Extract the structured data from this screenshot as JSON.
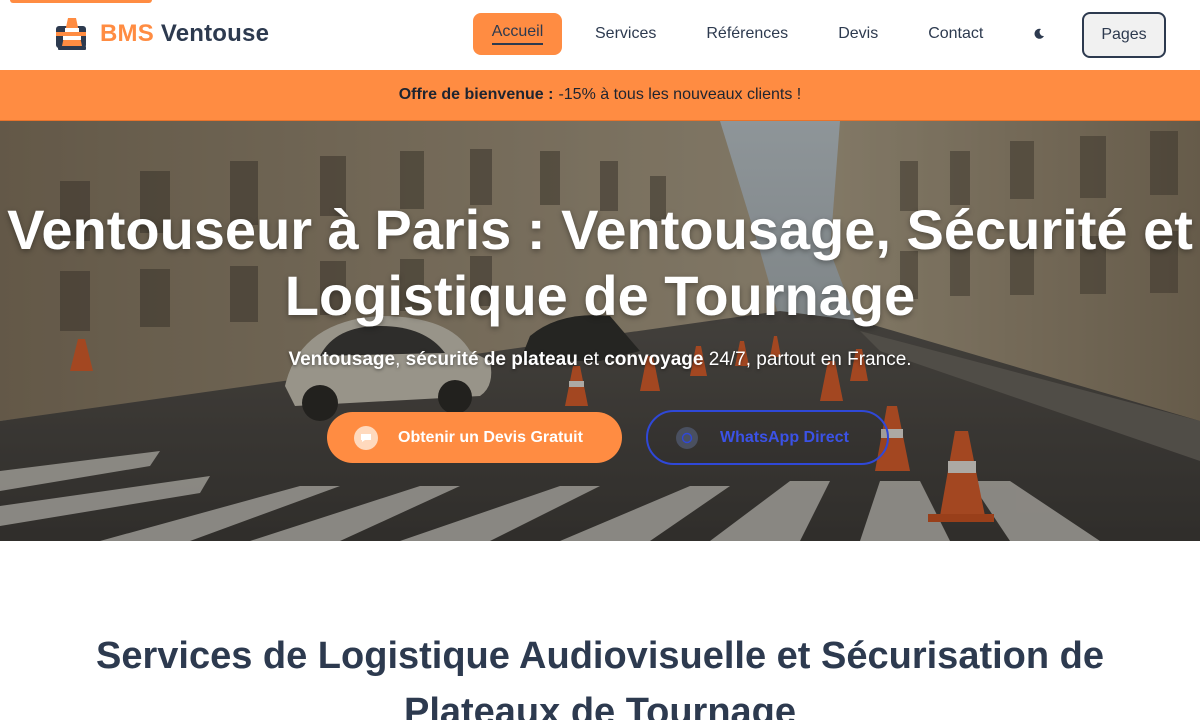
{
  "brand": {
    "name_part1": "BMS",
    "name_part2": "Ventouse"
  },
  "nav": {
    "items": [
      {
        "label": "Accueil",
        "active": true
      },
      {
        "label": "Services"
      },
      {
        "label": "Références"
      },
      {
        "label": "Devis"
      },
      {
        "label": "Contact"
      }
    ],
    "theme_icon": "moon-icon",
    "pages_label": "Pages"
  },
  "promo": {
    "label": "Offre de bienvenue :",
    "text": "-15% à tous les nouveaux clients !"
  },
  "hero": {
    "title": "Ventouseur à Paris : Ventousage, Sécurité et Logistique de Tournage",
    "subtitle": {
      "part1": "Ventousage",
      "part2": ", ",
      "part3": "sécurité de plateau",
      "part4": " et ",
      "part5": "convoyage",
      "part6": " 24/7, partout en France."
    },
    "cta_primary": {
      "label": "Obtenir un Devis Gratuit",
      "icon": "chat-bubble-icon"
    },
    "cta_secondary": {
      "label": "WhatsApp Direct",
      "icon": "whatsapp-icon"
    }
  },
  "services": {
    "title": "Services de Logistique Audiovisuelle et Sécurisation de Plateaux de Tournage"
  },
  "colors": {
    "accent": "#ff8c42",
    "navy": "#2d3a4f",
    "whatsapp_blue": "#2f48d8"
  }
}
